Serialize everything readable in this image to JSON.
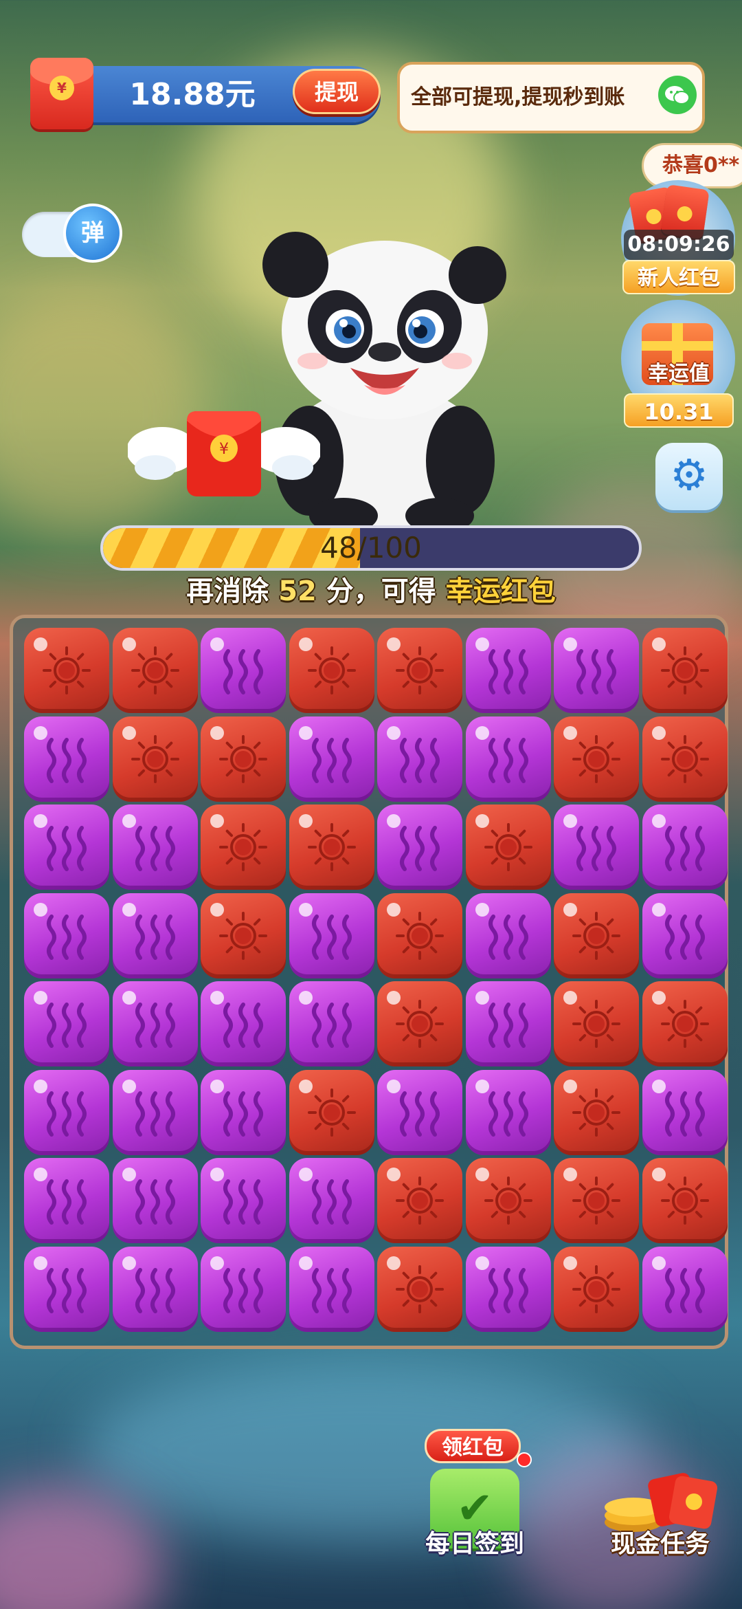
{
  "top_bar": {
    "balance": "18.88元",
    "withdraw_label": "提现",
    "withdraw_tip": "全部可提现,提现秒到账"
  },
  "toggle": {
    "label": "弹"
  },
  "right_panel": {
    "congrats_ticker": "恭喜0**",
    "countdown": "08:09:26",
    "newbie_label": "新人红包",
    "luck_label": "幸运值",
    "luck_value": "10.31"
  },
  "progress": {
    "current": 48,
    "total": 100,
    "text": "48/100",
    "fraction": 0.48
  },
  "bonus_hint": {
    "prefix": "再消除 ",
    "points": "52",
    "middle": " 分，可得 ",
    "reward": "幸运红包"
  },
  "board": {
    "rows": [
      [
        "red",
        "red",
        "purple",
        "red",
        "red",
        "purple",
        "purple",
        "red"
      ],
      [
        "purple",
        "red",
        "red",
        "purple",
        "purple",
        "purple",
        "red",
        "red"
      ],
      [
        "purple",
        "purple",
        "red",
        "red",
        "purple",
        "red",
        "purple",
        "purple"
      ],
      [
        "purple",
        "purple",
        "red",
        "purple",
        "red",
        "purple",
        "red",
        "purple"
      ],
      [
        "purple",
        "purple",
        "purple",
        "purple",
        "red",
        "purple",
        "red",
        "red"
      ],
      [
        "purple",
        "purple",
        "purple",
        "red",
        "purple",
        "purple",
        "red",
        "purple"
      ],
      [
        "purple",
        "purple",
        "purple",
        "purple",
        "red",
        "red",
        "red",
        "red"
      ],
      [
        "purple",
        "purple",
        "purple",
        "purple",
        "red",
        "purple",
        "red",
        "purple"
      ]
    ],
    "tile_icons": {
      "red": "sun-icon",
      "purple": "wave-icon"
    },
    "colors": {
      "red": "#d63b2b",
      "purple": "#b435d6"
    }
  },
  "bottom": {
    "red_packet_badge": "领红包",
    "daily_checkin": "每日签到",
    "cash_task": "现金任务"
  },
  "icons": {
    "red_envelope": "red-envelope-icon",
    "wechat": "wechat-icon",
    "settings": "gear-icon",
    "gift": "gift-box-icon",
    "panda": "panda-character"
  }
}
